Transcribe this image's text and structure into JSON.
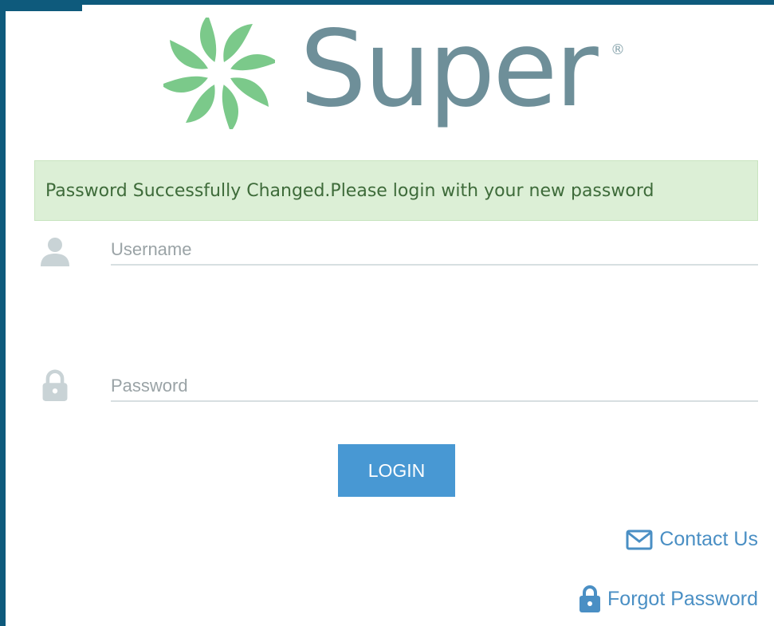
{
  "brand": {
    "name": "Super",
    "reg_mark": "®",
    "logo_color": "#6e8f99",
    "icon_color": "#7bc98a"
  },
  "alert": {
    "message": "Password Successfully Changed.Please login with your new password"
  },
  "form": {
    "username_placeholder": "Username",
    "password_placeholder": "Password",
    "login_label": "LOGIN"
  },
  "links": {
    "contact_label": "Contact Us",
    "forgot_label": "Forgot Password"
  },
  "icons": {
    "username": "user-icon",
    "password": "lock-icon",
    "contact": "envelope-icon",
    "forgot": "lock-icon"
  }
}
